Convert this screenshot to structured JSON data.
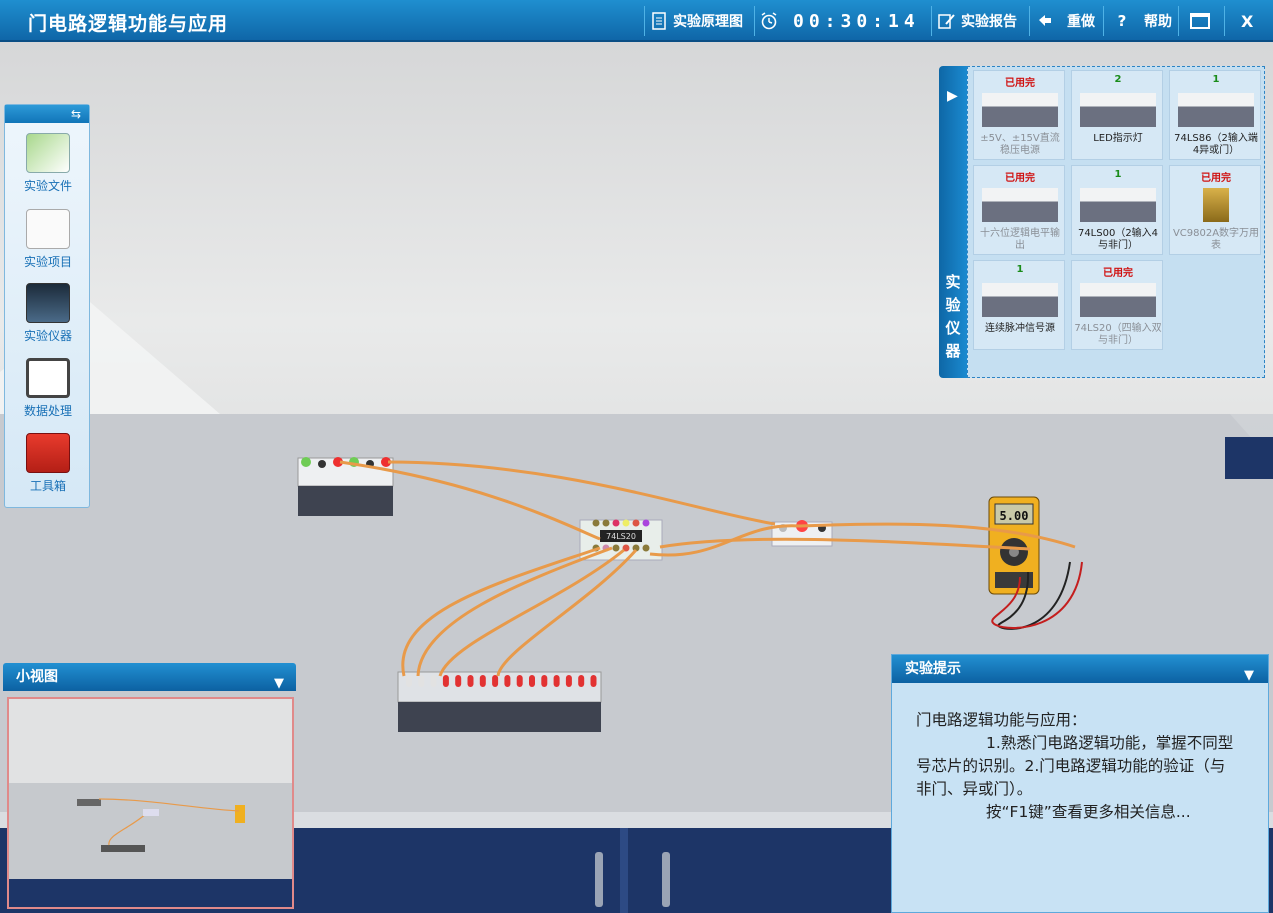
{
  "window": {
    "title": "门电路逻辑功能与应用",
    "toolbar": {
      "schematic": "实验原理图",
      "timer": "00:30:14",
      "report": "实验报告",
      "redo": "重做",
      "help_mark": "?",
      "help": "帮助",
      "close": "X"
    }
  },
  "left_toolbar": {
    "items": [
      {
        "label": "实验文件",
        "icon": "document-icon"
      },
      {
        "label": "实验项目",
        "icon": "checklist-icon"
      },
      {
        "label": "实验仪器",
        "icon": "monitor-icon"
      },
      {
        "label": "数据处理",
        "icon": "chart-icon"
      },
      {
        "label": "工具箱",
        "icon": "toolbox-icon"
      }
    ]
  },
  "instruments": {
    "tab_label": "实验仪器",
    "items": [
      {
        "count": "已用完",
        "used": true,
        "name": "±5V、±15V直流稳压电源"
      },
      {
        "count": "2",
        "used": false,
        "name": "LED指示灯"
      },
      {
        "count": "1",
        "used": false,
        "name": "74LS86（2输入端4异或门）"
      },
      {
        "count": "已用完",
        "used": true,
        "name": "十六位逻辑电平输出"
      },
      {
        "count": "1",
        "used": false,
        "name": "74LS00（2输入4与非门）"
      },
      {
        "count": "已用完",
        "used": true,
        "name": "VC9802A数字万用表"
      },
      {
        "count": "1",
        "used": false,
        "name": "连续脉冲信号源"
      },
      {
        "count": "已用完",
        "used": true,
        "name": "74LS20（四输入双与非门）"
      }
    ]
  },
  "multimeter": {
    "reading": "5.00"
  },
  "chip": {
    "label": "74LS20"
  },
  "minimap": {
    "title": "小视图"
  },
  "tips": {
    "title": "实验提示",
    "line1": "门电路逻辑功能与应用：",
    "line2": "1.熟悉门电路逻辑功能，掌握不同型号芯片的识别。2.门电路逻辑功能的验证（与非门、异或门）。",
    "line3": "按“F1键”查看更多相关信息..."
  },
  "colors": {
    "accent": "#1478bd",
    "used": "#d01010",
    "available": "#1a8c1a",
    "wire": "#e89a4a"
  }
}
